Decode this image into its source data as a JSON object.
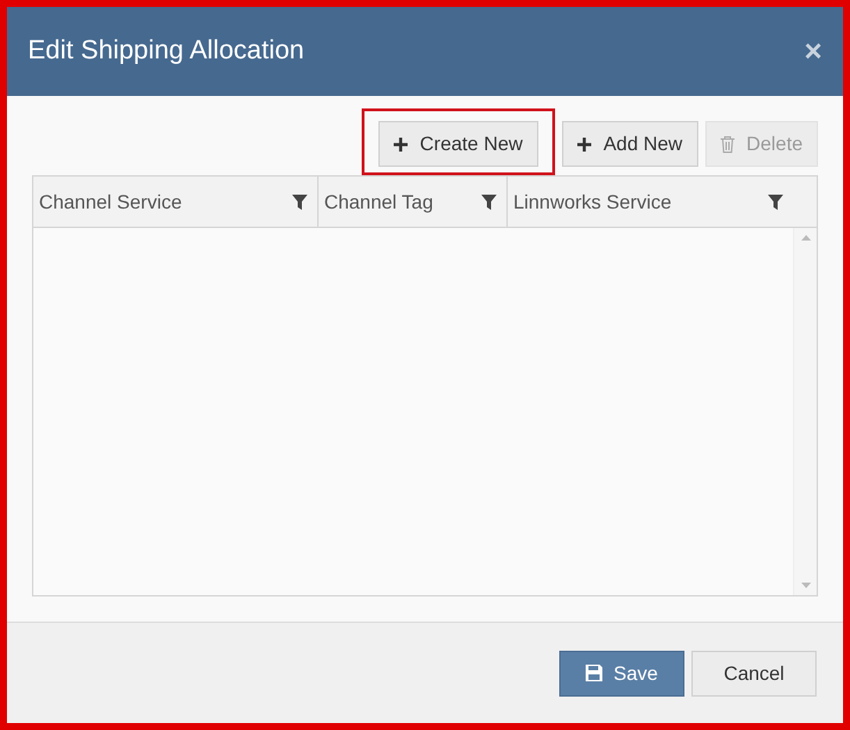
{
  "dialog": {
    "title": "Edit Shipping Allocation",
    "close": "×"
  },
  "toolbar": [
    {
      "kind": "create",
      "label": "Create New",
      "disabled": false,
      "highlighted": true
    },
    {
      "kind": "add",
      "label": "Add New",
      "disabled": false,
      "highlighted": false
    },
    {
      "kind": "delete",
      "label": "Delete",
      "disabled": true,
      "highlighted": false
    }
  ],
  "table": {
    "columns": [
      "Channel Service",
      "Channel Tag",
      "Linnworks Service"
    ]
  },
  "footer": [
    {
      "kind": "save",
      "label": "Save"
    },
    {
      "kind": "cancel",
      "label": "Cancel"
    }
  ]
}
